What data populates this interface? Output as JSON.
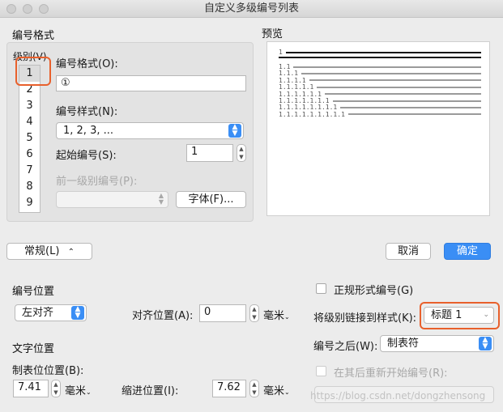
{
  "window": {
    "title": "自定义多级编号列表"
  },
  "numbering_format": {
    "section_title": "编号格式",
    "level_label": "级别(V)",
    "levels": [
      "1",
      "2",
      "3",
      "4",
      "5",
      "6",
      "7",
      "8",
      "9"
    ],
    "format_label": "编号格式(O):",
    "format_value": "①",
    "style_label": "编号样式(N):",
    "style_value": "1, 2, 3, ...",
    "start_label": "起始编号(S):",
    "start_value": "1",
    "prev_level_label": "前一级别编号(P):",
    "font_button": "字体(F)..."
  },
  "preview": {
    "title": "预览",
    "rows": [
      "1",
      "1.1",
      "1.1.1",
      "1.1.1.1",
      "1.1.1.1.1",
      "1.1.1.1.1.1",
      "1.1.1.1.1.1.1",
      "1.1.1.1.1.1.1.1",
      "1.1.1.1.1.1.1.1.1"
    ]
  },
  "toolbar": {
    "normal_button": "常规(L)",
    "normal_arrow": "⌃",
    "cancel_button": "取消",
    "ok_button": "确定"
  },
  "number_position": {
    "section_title": "编号位置",
    "align_value": "左对齐",
    "align_pos_label": "对齐位置(A):",
    "align_pos_value": "0",
    "unit": "毫米"
  },
  "text_position": {
    "section_title": "文字位置",
    "tab_label": "制表位位置(B):",
    "tab_value": "7.41",
    "indent_label": "缩进位置(I):",
    "indent_value": "7.62",
    "unit": "毫米"
  },
  "options": {
    "legal_label": "正规形式编号(G)",
    "link_label": "将级别链接到样式(K):",
    "link_value": "标题 1",
    "after_label": "编号之后(W):",
    "after_value": "制表符",
    "restart_label": "在其后重新开始编号(R):"
  },
  "watermark": "https://blog.csdn.net/dongzhensong",
  "accent_color": "#3a8ef5",
  "highlight_color": "#e8602c"
}
